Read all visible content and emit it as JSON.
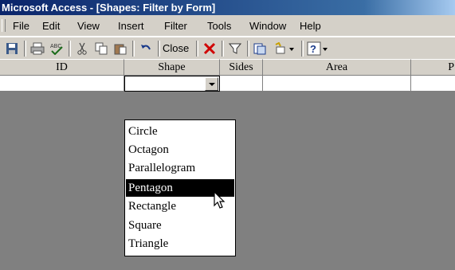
{
  "window": {
    "title": "Microsoft Access - [Shapes: Filter by Form]"
  },
  "menu": {
    "items": [
      {
        "label": "File"
      },
      {
        "label": "Edit"
      },
      {
        "label": "View"
      },
      {
        "label": "Insert"
      },
      {
        "label": "Filter"
      },
      {
        "label": "Tools"
      },
      {
        "label": "Window"
      },
      {
        "label": "Help"
      }
    ]
  },
  "toolbar": {
    "close_label": "Close",
    "icons": [
      "save-icon",
      "print-icon",
      "spelling-icon",
      "cut-icon",
      "copy-icon",
      "paste-icon",
      "undo-icon",
      "close-icon",
      "delete-icon",
      "apply-filter-icon",
      "new-object-icon",
      "help-icon"
    ]
  },
  "grid": {
    "columns": [
      {
        "label": "ID"
      },
      {
        "label": "Shape"
      },
      {
        "label": "Sides"
      },
      {
        "label": "Area"
      },
      {
        "label": "P"
      }
    ]
  },
  "dropdown": {
    "options": [
      "Circle",
      "Octagon",
      "Parallelogram",
      "Pentagon",
      "Rectangle",
      "Square",
      "Triangle"
    ],
    "selected": "Pentagon"
  },
  "colors": {
    "titlebar": "#0a246a",
    "face": "#d4d0c8",
    "workspace": "#808080",
    "selection": "#000000"
  }
}
